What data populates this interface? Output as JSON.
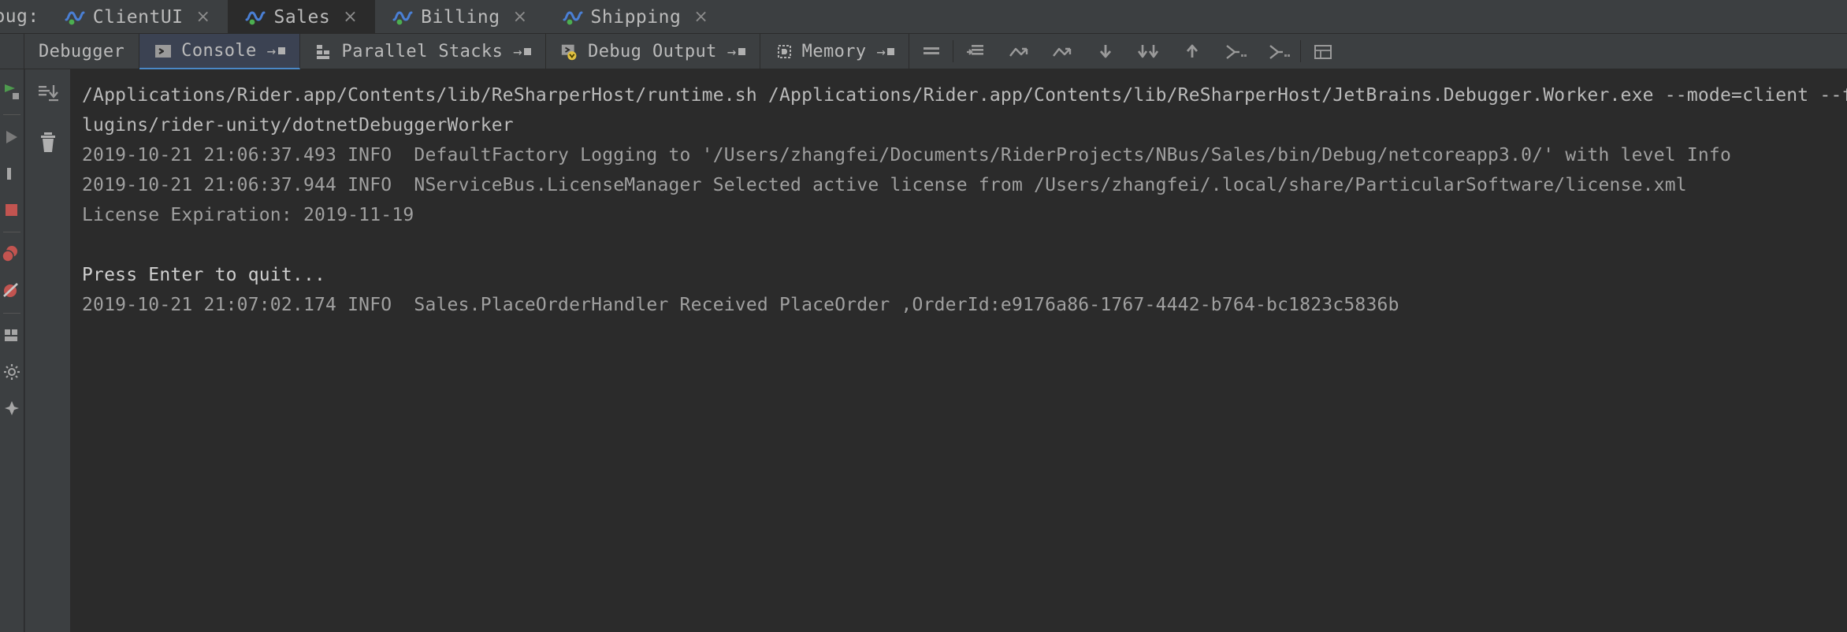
{
  "window": {
    "debug_label": "ebug:",
    "bg_color": "#3c3f41",
    "console_bg": "#2b2b2b",
    "accent_color": "#4a88c7"
  },
  "run_tabs": [
    {
      "label": "ClientUI",
      "icon": "nservicebus-endpoint-icon",
      "close": "×",
      "active": false
    },
    {
      "label": "Sales",
      "icon": "nservicebus-endpoint-icon",
      "close": "×",
      "active": true
    },
    {
      "label": "Billing",
      "icon": "nservicebus-endpoint-icon",
      "close": "×",
      "active": false
    },
    {
      "label": "Shipping",
      "icon": "nservicebus-endpoint-icon",
      "close": "×",
      "active": false
    }
  ],
  "tool_tabs": [
    {
      "label": "Debugger",
      "icon": null,
      "pin": "",
      "active": false
    },
    {
      "label": "Console",
      "icon": "console-icon",
      "pin": "→",
      "active": true
    },
    {
      "label": "Parallel Stacks",
      "icon": "parallel-stacks-icon",
      "pin": "→",
      "active": false
    },
    {
      "label": "Debug Output",
      "icon": "debug-output-icon",
      "pin": "→",
      "active": false
    },
    {
      "label": "Memory",
      "icon": "memory-icon",
      "pin": "→",
      "active": false
    }
  ],
  "toolbar_buttons": [
    {
      "name": "soft-wrap-icon",
      "title": "Use Soft Wraps"
    },
    {
      "name": "print-icon",
      "title": "Print"
    },
    {
      "name": "step-over-icon",
      "title": "Step Over"
    },
    {
      "name": "force-step-over-icon",
      "title": "Force Step Over"
    },
    {
      "name": "step-into-icon",
      "title": "Step Into"
    },
    {
      "name": "force-step-into-icon",
      "title": "Force Step Into"
    },
    {
      "name": "step-out-icon",
      "title": "Step Out"
    },
    {
      "name": "run-to-cursor-icon",
      "title": "Run to Cursor"
    },
    {
      "name": "force-run-to-cursor-icon",
      "title": "Force Run to Cursor"
    },
    {
      "name": "evaluate-table-icon",
      "title": "Evaluate Expression"
    }
  ],
  "gutter_buttons": [
    {
      "name": "rerun-icon",
      "title": "Rerun"
    },
    {
      "name": "resume-program-icon",
      "title": "Resume Program"
    },
    {
      "name": "pause-program-icon",
      "title": "Pause Program"
    },
    {
      "name": "stop-icon",
      "title": "Stop"
    },
    {
      "name": "view-breakpoints-icon",
      "title": "View Breakpoints"
    },
    {
      "name": "mute-breakpoints-icon",
      "title": "Mute Breakpoints"
    },
    {
      "name": "layout-settings-icon",
      "title": "Layout Settings"
    },
    {
      "name": "settings-gear-icon",
      "title": "Settings"
    },
    {
      "name": "pin-tab-icon",
      "title": "Pin Tab"
    }
  ],
  "console_gutter_buttons": [
    {
      "name": "scroll-to-end-icon",
      "title": "Scroll to End"
    },
    {
      "name": "trash-icon",
      "title": "Clear All"
    }
  ],
  "console_lines": [
    {
      "type": "sys",
      "text": "/Applications/Rider.app/Contents/lib/ReSharperHost/runtime.sh /Applications/Rider.app/Contents/lib/ReSharperHost/JetBrains.Debugger.Worker.exe --mode=client --f"
    },
    {
      "type": "sys",
      "text": "lugins/rider-unity/dotnetDebuggerWorker"
    },
    {
      "type": "log",
      "text": "2019-10-21 21:06:37.493 INFO  DefaultFactory Logging to '/Users/zhangfei/Documents/RiderProjects/NBus/Sales/bin/Debug/netcoreapp3.0/' with level Info"
    },
    {
      "type": "log",
      "text": "2019-10-21 21:06:37.944 INFO  NServiceBus.LicenseManager Selected active license from /Users/zhangfei/.local/share/ParticularSoftware/license.xml"
    },
    {
      "type": "log",
      "text": "License Expiration: 2019-11-19"
    },
    {
      "type": "blank",
      "text": ""
    },
    {
      "type": "prompt",
      "text": "Press Enter to quit..."
    },
    {
      "type": "log",
      "text": "2019-10-21 21:07:02.174 INFO  Sales.PlaceOrderHandler Received PlaceOrder ,OrderId:e9176a86-1767-4442-b764-bc1823c5836b"
    }
  ]
}
